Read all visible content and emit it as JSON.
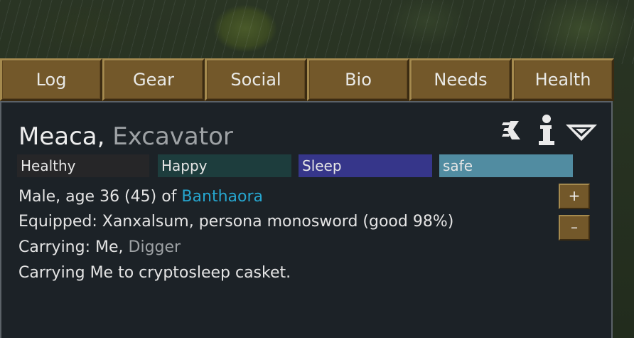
{
  "tabs": [
    {
      "label": "Log"
    },
    {
      "label": "Gear"
    },
    {
      "label": "Social"
    },
    {
      "label": "Bio"
    },
    {
      "label": "Needs"
    },
    {
      "label": "Health"
    }
  ],
  "pawn": {
    "name": "Meaca",
    "separator": ", ",
    "title": "Excavator"
  },
  "icons": [
    "draft-icon",
    "info-icon",
    "collapse-icon"
  ],
  "status_bars": [
    {
      "label": "Healthy",
      "color": "#262628"
    },
    {
      "label": "Happy",
      "color": "#1d3d3d"
    },
    {
      "label": "Sleep",
      "color": "#36368a"
    },
    {
      "label": "safe",
      "color": "#518ca1"
    }
  ],
  "info": {
    "line1_prefix": "Male, age 36 (45) of ",
    "faction": "Banthaora",
    "equipped": "Equipped: Xanxalsum, persona monosword (good 98%)",
    "carrying_prefix": "Carrying: Me",
    "carrying_separator": ", ",
    "carrying_role": "Digger",
    "job": "Carrying Me to cryptosleep casket."
  },
  "buttons": {
    "plus": "+",
    "minus": "–"
  },
  "colors": {
    "link": "#26a6cf",
    "tab_fill": "#73582a",
    "panel_bg": "#1c2227"
  }
}
